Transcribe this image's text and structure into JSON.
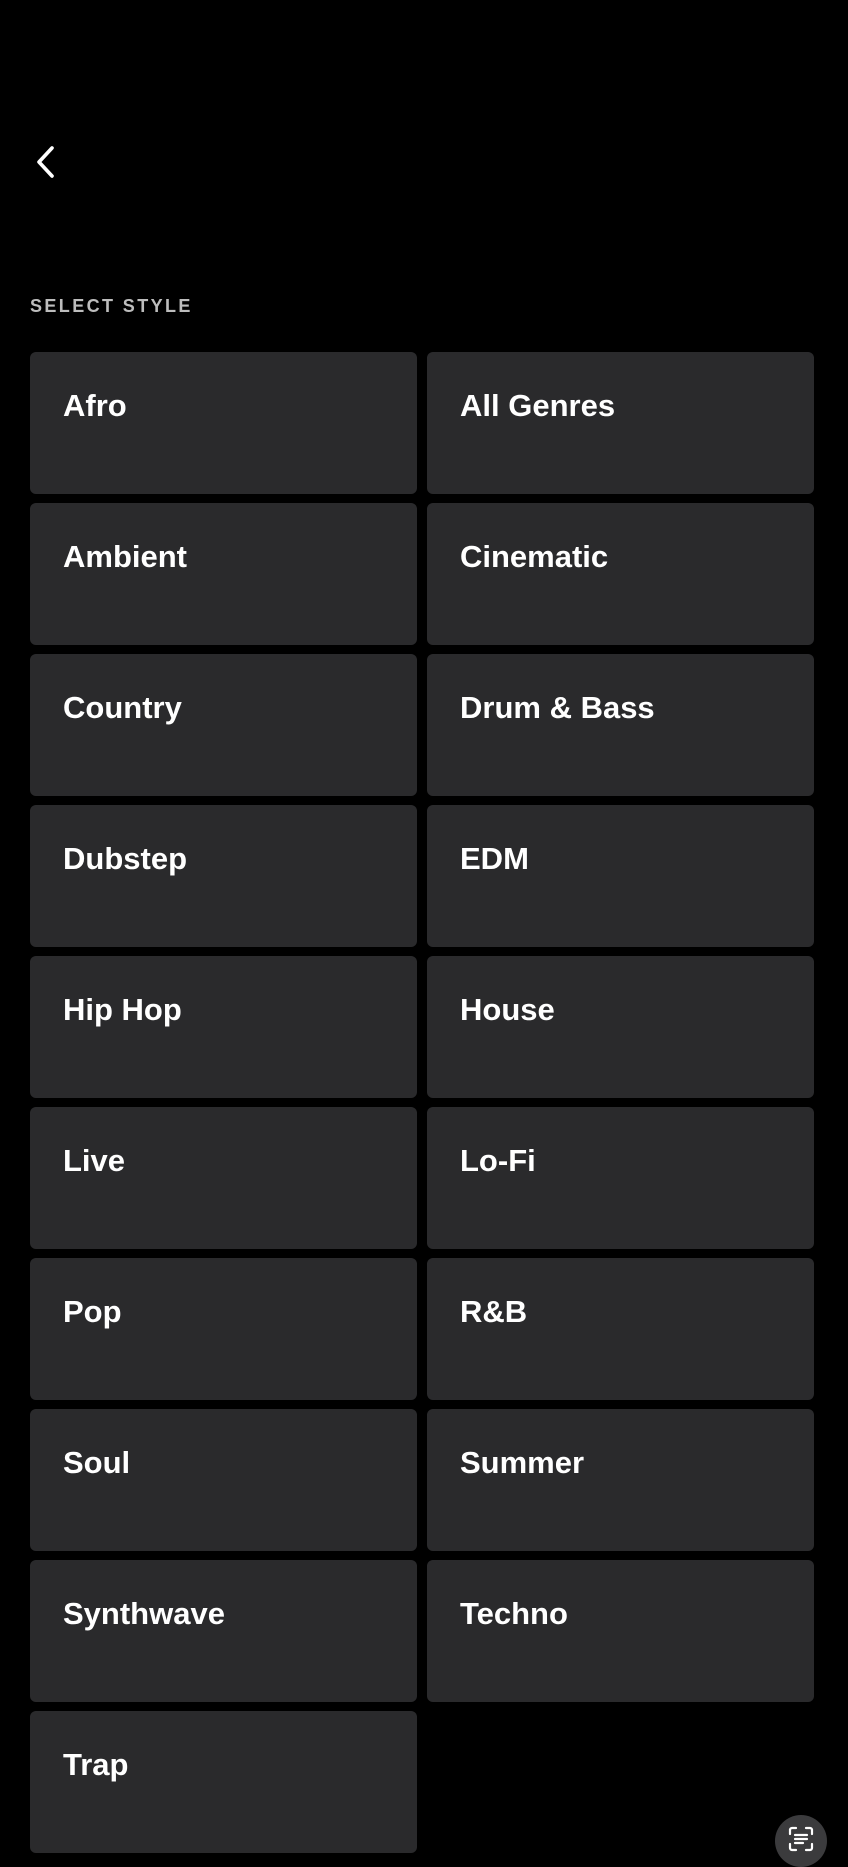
{
  "header": {
    "back_icon": "chevron-left-icon"
  },
  "section": {
    "label": "SELECT STYLE"
  },
  "styles": [
    "Afro",
    "All Genres",
    "Ambient",
    "Cinematic",
    "Country",
    "Drum & Bass",
    "Dubstep",
    "EDM",
    "Hip Hop",
    "House",
    "Live",
    "Lo-Fi",
    "Pop",
    "R&B",
    "Soul",
    "Summer",
    "Synthwave",
    "Techno",
    "Trap"
  ],
  "floating": {
    "icon": "text-scan-icon"
  },
  "colors": {
    "background": "#000000",
    "tile": "#2a2a2c",
    "label": "#bdbdbd",
    "text": "#ffffff"
  }
}
